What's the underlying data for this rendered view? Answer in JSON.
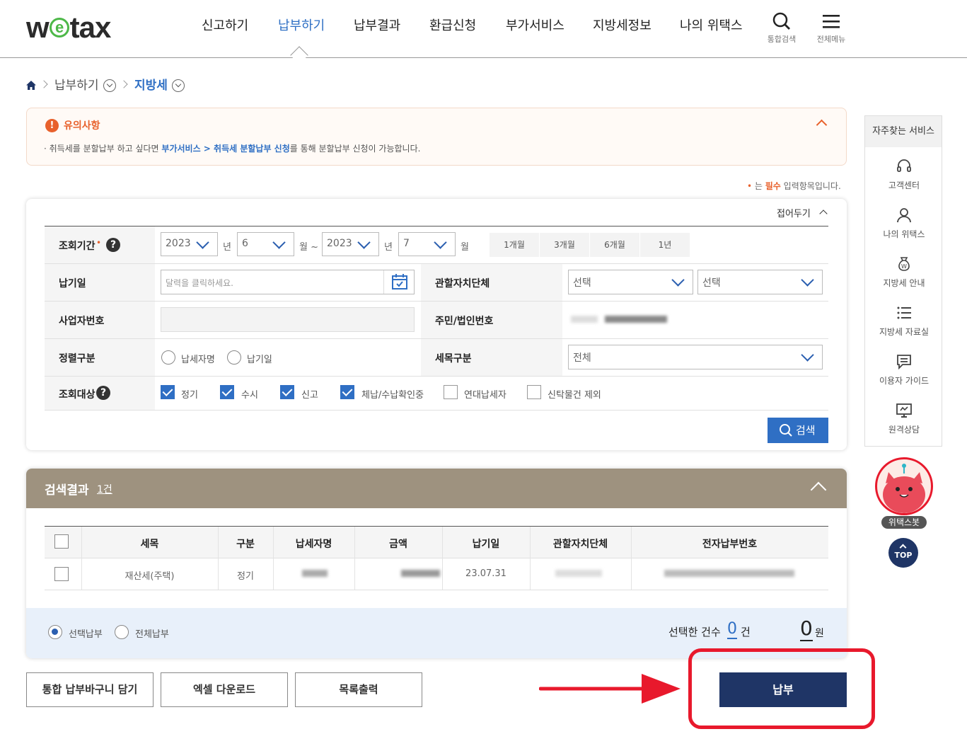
{
  "header": {
    "logo_pre": "w",
    "logo_e": "e",
    "logo_post": "tax",
    "nav": [
      "신고하기",
      "납부하기",
      "납부결과",
      "환급신청",
      "부가서비스",
      "지방세정보",
      "나의 위택스"
    ],
    "active_nav": "납부하기",
    "search_label": "통합검색",
    "menu_label": "전체메뉴"
  },
  "breadcrumb": {
    "level1": "납부하기",
    "level2": "지방세"
  },
  "notice": {
    "title": "유의사항",
    "text_pre": "· 취득세를 분할납부 하고 싶다면 ",
    "text_link": "부가서비스 > 취득세 분할납부 신청",
    "text_post": "를 통해 분할납부 신청이 가능합니다."
  },
  "required_note": {
    "pre": "는 ",
    "strong": "필수",
    "post": " 입력항목입니다."
  },
  "search_form": {
    "collapse_label": "접어두기",
    "period_label": "조회기간",
    "start_year": "2023",
    "start_month": "6",
    "end_year": "2023",
    "end_month": "7",
    "year_unit": "년",
    "month_unit_tilde": "월 ~",
    "month_unit": "월",
    "period_buttons": [
      "1개월",
      "3개월",
      "6개월",
      "1년"
    ],
    "due_date_label": "납기일",
    "due_date_placeholder": "달력을 클릭하세요.",
    "authority_label": "관할자치단체",
    "authority_select1": "선택",
    "authority_select2": "선택",
    "business_no_label": "사업자번호",
    "resident_no_label": "주민/법인번호",
    "sort_label": "정렬구분",
    "sort_options": [
      "납세자명",
      "납기일"
    ],
    "tax_type_label": "세목구분",
    "tax_type_value": "전체",
    "target_label": "조회대상",
    "target_options": [
      {
        "label": "정기",
        "checked": true
      },
      {
        "label": "수시",
        "checked": true
      },
      {
        "label": "신고",
        "checked": true
      },
      {
        "label": "체납/수납확인중",
        "checked": true
      },
      {
        "label": "연대납세자",
        "checked": false
      },
      {
        "label": "신탁물건 제외",
        "checked": false
      }
    ],
    "search_button": "검색"
  },
  "results": {
    "title": "검색결과",
    "count": "1건",
    "columns": [
      "세목",
      "구분",
      "납세자명",
      "금액",
      "납기일",
      "관할자치단체",
      "전자납부번호"
    ],
    "rows": [
      {
        "tax_item": "재산세(주택)",
        "type": "정기",
        "due": "23.07.31"
      }
    ],
    "pay_options": [
      "선택납부",
      "전체납부"
    ],
    "selected_count_label": "선택한 건수",
    "selected_count": "0",
    "count_unit": "건",
    "amount": "0",
    "amount_unit": "원"
  },
  "buttons": {
    "cart": "통합 납부바구니 담기",
    "excel": "엑셀 다운로드",
    "print": "목록출력",
    "pay": "납부"
  },
  "side": {
    "title": "자주찾는 서비스",
    "items": [
      "고객센터",
      "나의 위택스",
      "지방세 안내",
      "지방세 자료실",
      "이용자 가이드",
      "원격상담"
    ],
    "bot_label": "위택스봇",
    "top_label": "TOP"
  },
  "colors": {
    "accent": "#2f6fc4",
    "pay_button": "#1f3566",
    "result_header": "#9e927f",
    "highlight": "#e8192c",
    "notice": "#e8612c"
  }
}
